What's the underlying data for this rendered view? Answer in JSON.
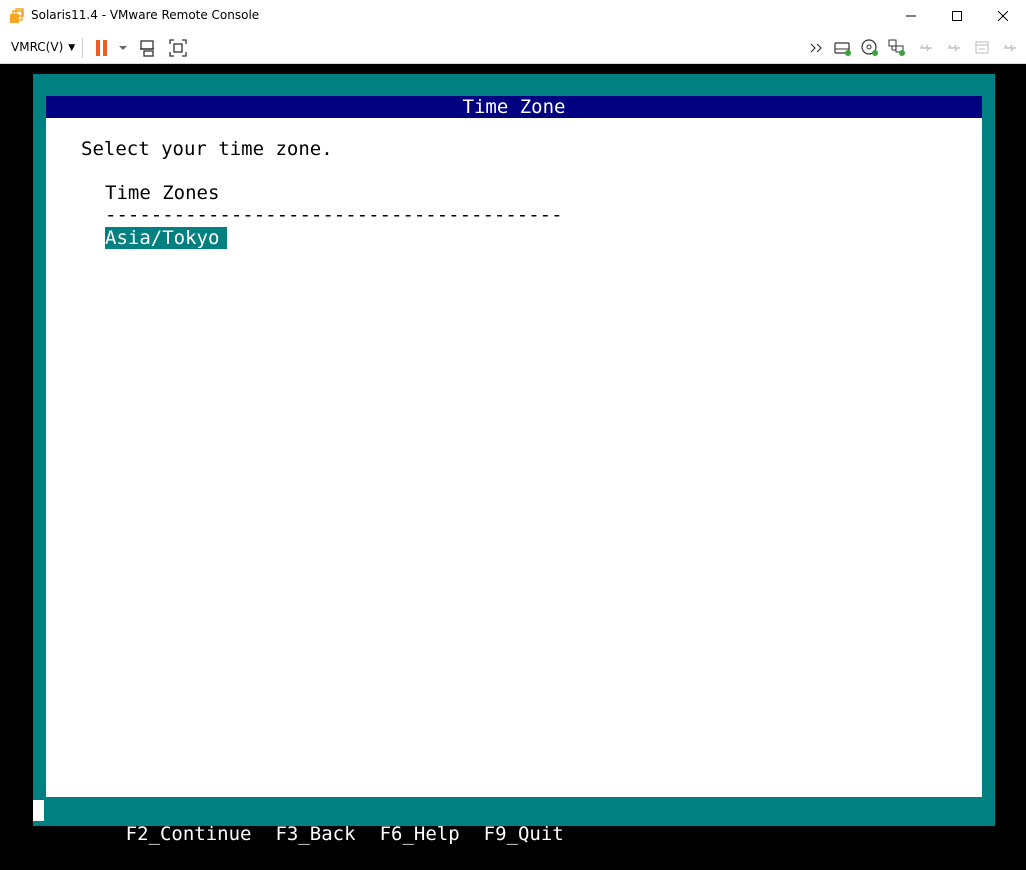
{
  "window": {
    "title": "Solaris11.4 - VMware Remote Console",
    "icon": "vmware-vmrc-icon"
  },
  "toolbar": {
    "vmrc_menu_label": "VMRC(V)",
    "icons_left": [
      "pause-icon",
      "chevron-down-icon",
      "send-ctrl-alt-del-icon",
      "fullscreen-icon"
    ],
    "icons_right": [
      "chevron-right-double-icon",
      "hard-disk-icon",
      "cd-rom-icon",
      "network-adapter-icon",
      "usb-icon",
      "usb-icon",
      "printer-icon"
    ]
  },
  "colors": {
    "teal": "#008080",
    "header_navy": "#000080",
    "pause_orange": "#f05a23"
  },
  "installer": {
    "header_title": "Time Zone",
    "prompt": "Select your time zone.",
    "list_header": "Time Zones",
    "list_rule": "----------------------------------------",
    "selected_item": "Asia/Tokyo",
    "fkeys": [
      "F2_Continue",
      "F3_Back",
      "F6_Help",
      "F9_Quit"
    ]
  }
}
